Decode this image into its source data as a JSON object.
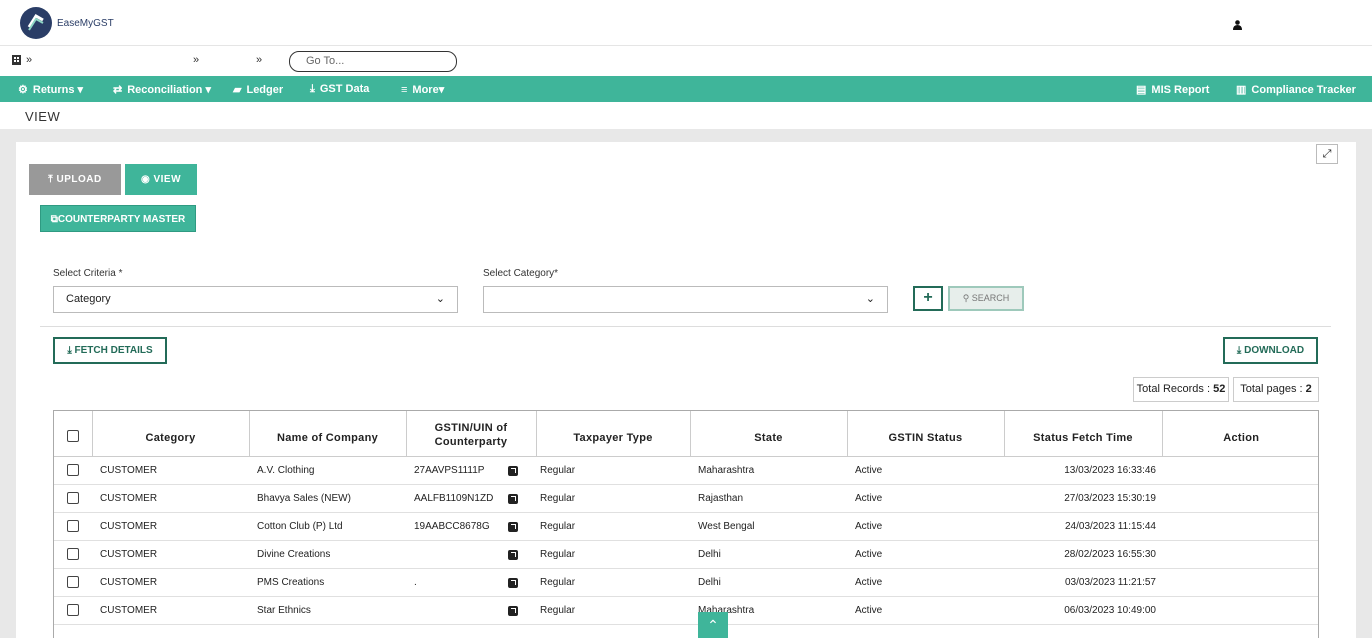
{
  "app": {
    "brand": "EaseMyGST"
  },
  "breadcrumb": {
    "sep1": "»",
    "sep2": "»",
    "sep3": "»",
    "goto_placeholder": "Go To..."
  },
  "nav": {
    "returns": "Returns",
    "reconciliation": "Reconciliation",
    "ledger": "Ledger",
    "gst_data": "GST Data",
    "more": "More",
    "mis_report": "MIS Report",
    "compliance_tracker": "Compliance Tracker"
  },
  "page": {
    "title": "VIEW"
  },
  "buttons": {
    "upload": "UPLOAD",
    "view": "VIEW",
    "counterparty_master": "COUNTERPARTY MASTER",
    "search": "SEARCH",
    "plus": "+",
    "fetch_details": "FETCH DETAILS",
    "download": "DOWNLOAD"
  },
  "filters": {
    "criteria_label": "Select Criteria *",
    "criteria_value": "Category",
    "category_label": "Select Category*",
    "category_value": ""
  },
  "stats": {
    "total_records": "Total Records : ",
    "total_records_value": "52",
    "total_pages": "Total pages : ",
    "total_pages_value": "2"
  },
  "table": {
    "headers": {
      "category": "Category",
      "company": "Name of Company",
      "gstin_line1": "GSTIN/UIN of",
      "gstin_line2": "Counterparty",
      "taxpayer": "Taxpayer Type",
      "state": "State",
      "status": "GSTIN Status",
      "fetch_time": "Status Fetch Time",
      "action": "Action"
    },
    "rows": [
      {
        "category": "CUSTOMER",
        "company": "A.V. Clothing",
        "gstin": "27AAVPS1111P",
        "taxpayer": "Regular",
        "state": "Maharashtra",
        "status": "Active",
        "fetch_time": "13/03/2023 16:33:46"
      },
      {
        "category": "CUSTOMER",
        "company": "Bhavya Sales (NEW)",
        "gstin": "AALFB1109N1ZD",
        "taxpayer": "Regular",
        "state": "Rajasthan",
        "status": "Active",
        "fetch_time": "27/03/2023 15:30:19"
      },
      {
        "category": "CUSTOMER",
        "company": "Cotton Club (P) Ltd",
        "gstin": "19AABCC8678G",
        "taxpayer": "Regular",
        "state": "West Bengal",
        "status": "Active",
        "fetch_time": "24/03/2023 11:15:44"
      },
      {
        "category": "CUSTOMER",
        "company": "Divine Creations",
        "gstin": "",
        "taxpayer": "Regular",
        "state": "Delhi",
        "status": "Active",
        "fetch_time": "28/02/2023 16:55:30"
      },
      {
        "category": "CUSTOMER",
        "company": "PMS Creations",
        "gstin": ".",
        "taxpayer": "Regular",
        "state": "Delhi",
        "status": "Active",
        "fetch_time": "03/03/2023 11:21:57"
      },
      {
        "category": "CUSTOMER",
        "company": "Star Ethnics",
        "gstin": "",
        "taxpayer": "Regular",
        "state": "Maharashtra",
        "status": "Active",
        "fetch_time": "06/03/2023 10:49:00"
      }
    ]
  }
}
